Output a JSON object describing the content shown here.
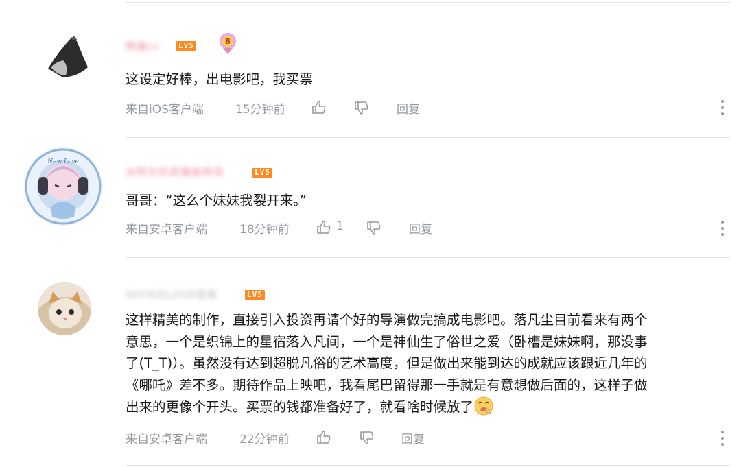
{
  "comments": [
    {
      "username": "啊唐cc",
      "level": "LV5",
      "content": [
        "这设定好棒，出电影吧，我买票"
      ],
      "source": "来自iOS客户端",
      "time": "15分钟前",
      "likes": "",
      "reply_label": "回复"
    },
    {
      "username": "对阿尔托莉雅胎特攻",
      "level": "LV5",
      "content": [
        "哥哥：“这么个妹妹我裂开来。”"
      ],
      "source": "来自安卓客户端",
      "time": "18分钟前",
      "likes": "1",
      "reply_label": "回复"
    },
    {
      "username": "SHYKIELOVE呢呢",
      "level": "LV5",
      "content": [
        "这样精美的制作，直接引入投资再请个好的导演做完搞成电影吧。落凡尘目前看来有两个",
        "意思，一个是织锦上的星宿落入凡间，一个是神仙生了俗世之爱（卧槽是妹妹啊，那没事",
        "了(T_T)）。虽然没有达到超脱凡俗的艺术高度，但是做出来能到达的成就应该跟近几年的",
        "《哪吒》差不多。期待作品上映吧，我看尾巴留得那一手就是有意想做后面的，这样子做",
        "出来的更像个开头。买票的钱都准备好了，就看啥时候放了"
      ],
      "source": "来自安卓客户端",
      "time": "22分钟前",
      "likes": "",
      "reply_label": "回复"
    }
  ],
  "icons": [
    "like-icon",
    "dislike-icon",
    "more-icon",
    "emoji-icon",
    "medal-icon"
  ],
  "colors": {
    "level_badge": "#ff8a24",
    "vip_name": "#f08da0",
    "meta_text": "#9499a0",
    "divider": "#e3e5e7"
  }
}
